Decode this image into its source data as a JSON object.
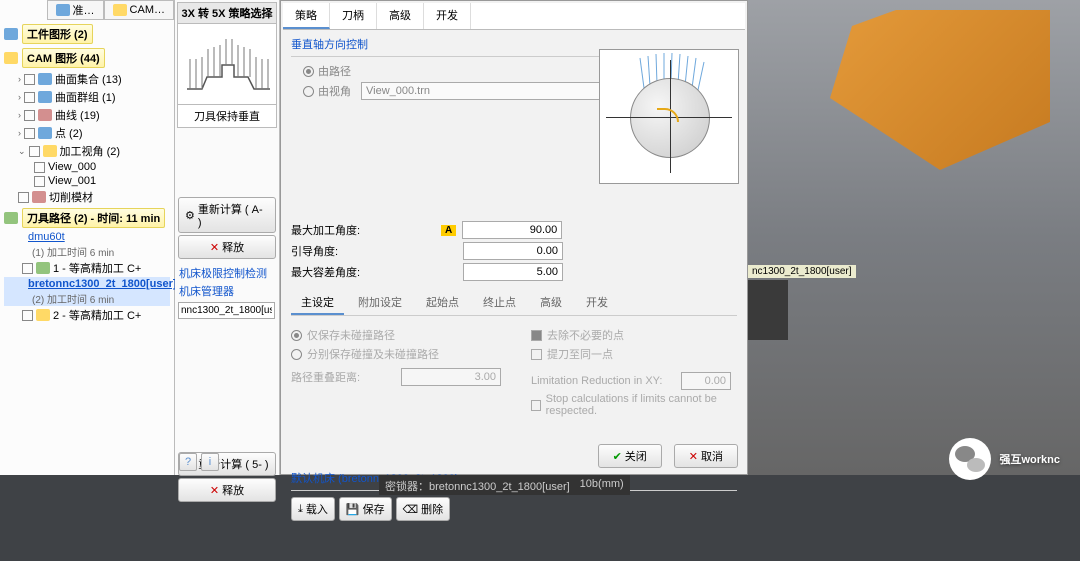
{
  "top_tabs": {
    "prep": "准…",
    "cam": "CAM…"
  },
  "tree": {
    "section1": {
      "title": "工件图形 (2)"
    },
    "section2": {
      "title": "CAM 图形 (44)",
      "items": [
        {
          "label": "曲面集合 (13)"
        },
        {
          "label": "曲面群组 (1)"
        },
        {
          "label": "曲线 (19)"
        },
        {
          "label": "点 (2)"
        },
        {
          "label": "加工视角 (2)",
          "expanded": true,
          "children": [
            {
              "label": "View_000"
            },
            {
              "label": "View_001"
            }
          ]
        },
        {
          "label": "切削模材"
        }
      ]
    },
    "section3": {
      "title": "刀具路径 (2) - 时间: 11 min",
      "items": [
        {
          "label": "dmu60t",
          "sub": "(1) 加工时间 6 min"
        },
        {
          "label": "1 - 等高精加工 C+",
          "icon": "grn"
        },
        {
          "label": "bretonnc1300_2t_1800[user]",
          "sub": "(2) 加工时间 6 min",
          "sel": true
        },
        {
          "label": "2 - 等高精加工 C+",
          "icon": "yel"
        }
      ]
    }
  },
  "mid": {
    "strip_title": "3X 转 5X 策略选择",
    "strip_caption": "刀具保持垂直",
    "recalc1": "重新计算 ( A- )",
    "release": "释放",
    "sec_limit": "机床极限控制检测",
    "sec_mgr": "机床管理器",
    "mgr_value": "nnc1300_2t_1800[user]",
    "recalc2": "重新计算 ( 5- )"
  },
  "dialog": {
    "tabs": [
      "策略",
      "刀柄",
      "高级",
      "开发"
    ],
    "group1": "垂直轴方向控制",
    "rad1": "由路径",
    "rad2": "由视角",
    "view_value": "View_000.trn",
    "row_max_angle": {
      "label": "最大加工角度:",
      "value": "90.00"
    },
    "row_lead": {
      "label": "引导角度:",
      "value": "0.00"
    },
    "row_tol": {
      "label": "最大容差角度:",
      "value": "5.00"
    },
    "subtabs": [
      "主设定",
      "附加设定",
      "起始点",
      "终止点",
      "高级",
      "开发"
    ],
    "opt1": "仅保存未碰撞路径",
    "opt2": "分别保存碰撞及未碰撞路径",
    "overlap_label": "路径重叠距离:",
    "overlap_value": "3.00",
    "chk1": "去除不必要的点",
    "chk2": "提刀至同一点",
    "lim_label": "Limitation Reduction in XY:",
    "lim_value": "0.00",
    "chk3": "Stop calculations if limits cannot be respected.",
    "default_machine_label": "默认机床 (bretonnc1300_2t_1800)",
    "btn_load": "载入",
    "btn_save": "保存",
    "btn_del": "删除",
    "btn_close": "关闭",
    "btn_cancel": "取消"
  },
  "viewport": {
    "label": "nc1300_2t_1800[user]"
  },
  "statusbar": {
    "a": "密锁器：bretonnc1300_2t_1800[user]",
    "b": "10b(mm)"
  },
  "wechat": "强互worknc"
}
